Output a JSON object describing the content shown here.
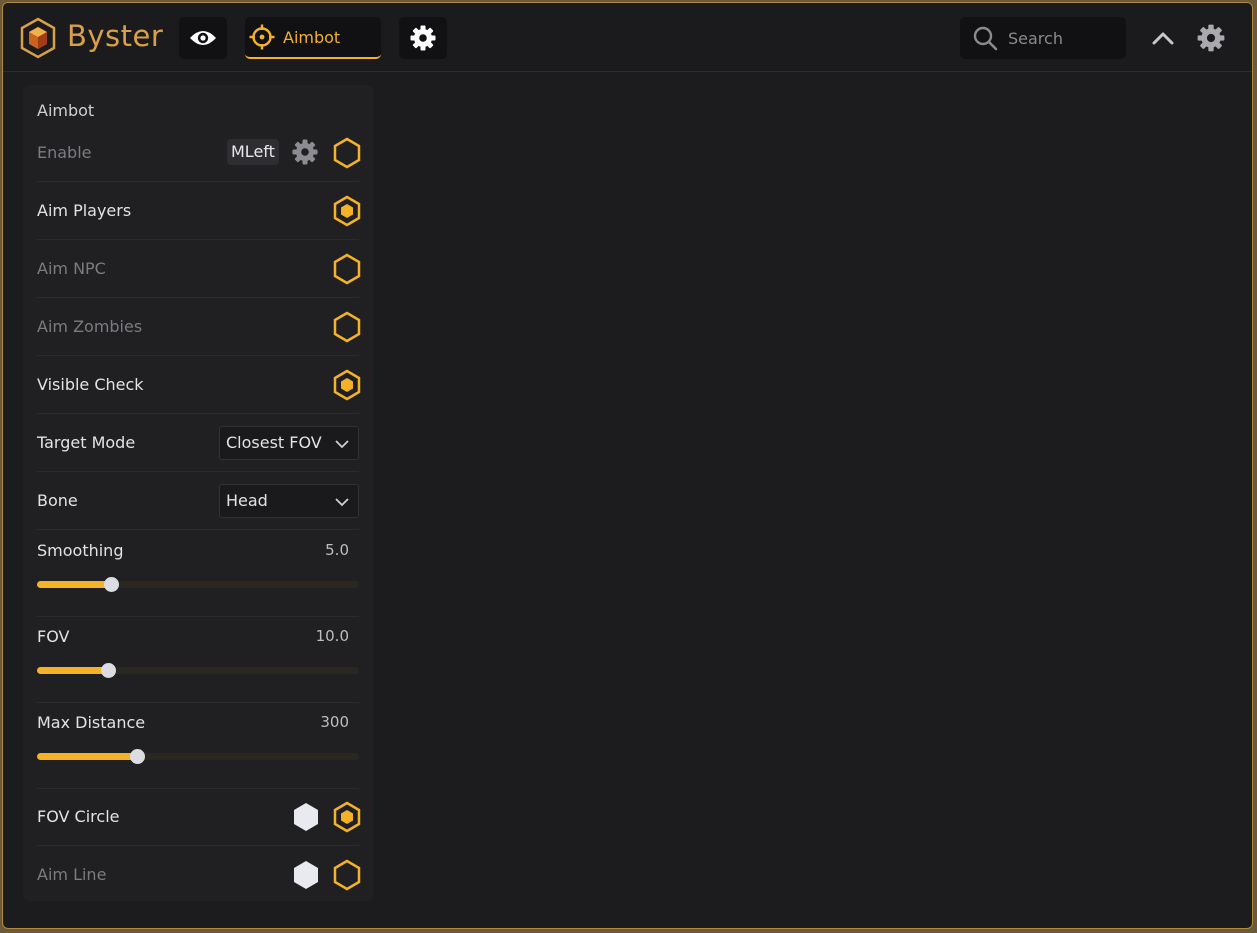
{
  "app": {
    "name": "Byster"
  },
  "tabs": [
    {
      "icon": "eye-icon",
      "label": ""
    },
    {
      "icon": "crosshair-icon",
      "label": "Aimbot",
      "active": true
    },
    {
      "icon": "gear-icon",
      "label": ""
    }
  ],
  "search": {
    "placeholder": "Search"
  },
  "colors": {
    "accent": "#f3b228",
    "background": "#1c1c1e",
    "panel": "#202023"
  },
  "panel": {
    "title": "Aimbot",
    "enable": {
      "label": "Enable",
      "key": "MLeft",
      "checked": false
    },
    "toggles": [
      {
        "label": "Aim Players",
        "checked": true
      },
      {
        "label": "Aim NPC",
        "checked": false
      },
      {
        "label": "Aim Zombies",
        "checked": false
      },
      {
        "label": "Visible Check",
        "checked": true
      }
    ],
    "target_mode": {
      "label": "Target Mode",
      "value": "Closest FOV"
    },
    "bone": {
      "label": "Bone",
      "value": "Head"
    },
    "sliders": [
      {
        "label": "Smoothing",
        "value": "5.0",
        "fraction": 0.23
      },
      {
        "label": "FOV",
        "value": "10.0",
        "fraction": 0.22
      },
      {
        "label": "Max Distance",
        "value": "300",
        "fraction": 0.31
      }
    ],
    "fov_circle": {
      "label": "FOV Circle",
      "color": "#e8eaf0",
      "checked": true
    },
    "aim_line": {
      "label": "Aim Line",
      "color": "#e8eaf0",
      "checked": false
    }
  }
}
